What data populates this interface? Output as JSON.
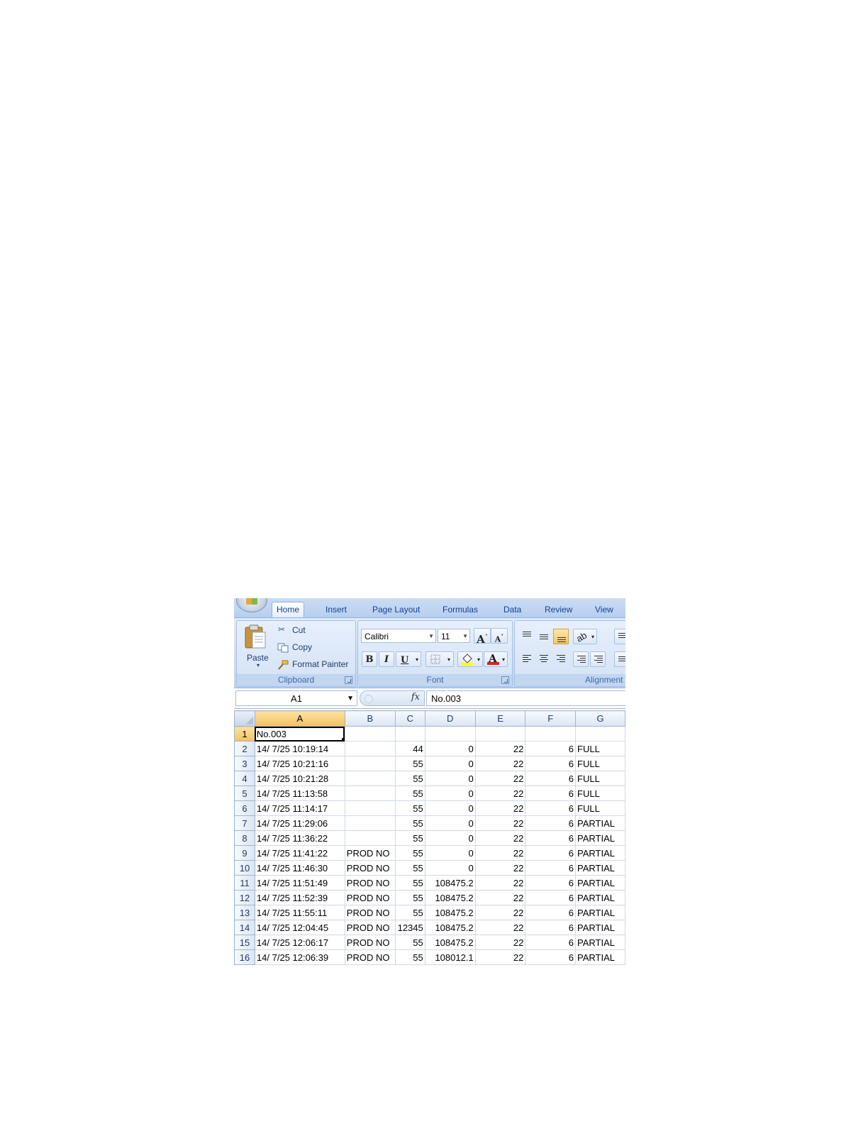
{
  "ribbon": {
    "tabs": [
      "Home",
      "Insert",
      "Page Layout",
      "Formulas",
      "Data",
      "Review",
      "View"
    ],
    "active_tab": "Home",
    "clipboard": {
      "paste_label": "Paste",
      "cut_label": "Cut",
      "copy_label": "Copy",
      "format_painter_label": "Format Painter",
      "group_label": "Clipboard"
    },
    "font": {
      "font_name": "Calibri",
      "font_size": "11",
      "group_label": "Font",
      "bold": "B",
      "italic": "I",
      "underline": "U",
      "grow": "A",
      "shrink": "A",
      "font_color_glyph": "A",
      "font_color": "#e02020",
      "fill_color": "#ffff00"
    },
    "alignment": {
      "group_label": "Alignment",
      "active_vertical": "bottom"
    }
  },
  "formula_bar": {
    "name_box": "A1",
    "fx": "fx",
    "formula": "No.003"
  },
  "sheet": {
    "columns": [
      "A",
      "B",
      "C",
      "D",
      "E",
      "F",
      "G"
    ],
    "selected_column": "A",
    "selected_row": "1",
    "rows": [
      {
        "n": "1",
        "a": "No.003",
        "b": "",
        "c": "",
        "d": "",
        "e": "",
        "f": "",
        "g": ""
      },
      {
        "n": "2",
        "a": "14/ 7/25 10:19:14",
        "b": "",
        "c": "44",
        "d": "0",
        "e": "22",
        "f": "6",
        "g": "FULL"
      },
      {
        "n": "3",
        "a": "14/ 7/25 10:21:16",
        "b": "",
        "c": "55",
        "d": "0",
        "e": "22",
        "f": "6",
        "g": "FULL"
      },
      {
        "n": "4",
        "a": "14/ 7/25 10:21:28",
        "b": "",
        "c": "55",
        "d": "0",
        "e": "22",
        "f": "6",
        "g": "FULL"
      },
      {
        "n": "5",
        "a": "14/ 7/25 11:13:58",
        "b": "",
        "c": "55",
        "d": "0",
        "e": "22",
        "f": "6",
        "g": "FULL"
      },
      {
        "n": "6",
        "a": "14/ 7/25 11:14:17",
        "b": "",
        "c": "55",
        "d": "0",
        "e": "22",
        "f": "6",
        "g": "FULL"
      },
      {
        "n": "7",
        "a": "14/ 7/25 11:29:06",
        "b": "",
        "c": "55",
        "d": "0",
        "e": "22",
        "f": "6",
        "g": "PARTIAL"
      },
      {
        "n": "8",
        "a": "14/ 7/25 11:36:22",
        "b": "",
        "c": "55",
        "d": "0",
        "e": "22",
        "f": "6",
        "g": "PARTIAL"
      },
      {
        "n": "9",
        "a": "14/ 7/25 11:41:22",
        "b": "PROD NO",
        "c": "55",
        "d": "0",
        "e": "22",
        "f": "6",
        "g": "PARTIAL"
      },
      {
        "n": "10",
        "a": "14/ 7/25 11:46:30",
        "b": "PROD NO",
        "c": "55",
        "d": "0",
        "e": "22",
        "f": "6",
        "g": "PARTIAL"
      },
      {
        "n": "11",
        "a": "14/ 7/25 11:51:49",
        "b": "PROD NO",
        "c": "55",
        "d": "108475.2",
        "e": "22",
        "f": "6",
        "g": "PARTIAL"
      },
      {
        "n": "12",
        "a": "14/ 7/25 11:52:39",
        "b": "PROD NO",
        "c": "55",
        "d": "108475.2",
        "e": "22",
        "f": "6",
        "g": "PARTIAL"
      },
      {
        "n": "13",
        "a": "14/ 7/25 11:55:11",
        "b": "PROD NO",
        "c": "55",
        "d": "108475.2",
        "e": "22",
        "f": "6",
        "g": "PARTIAL"
      },
      {
        "n": "14",
        "a": "14/ 7/25 12:04:45",
        "b": "PROD NO",
        "c": "12345",
        "d": "108475.2",
        "e": "22",
        "f": "6",
        "g": "PARTIAL"
      },
      {
        "n": "15",
        "a": "14/ 7/25 12:06:17",
        "b": "PROD NO",
        "c": "55",
        "d": "108475.2",
        "e": "22",
        "f": "6",
        "g": "PARTIAL"
      },
      {
        "n": "16",
        "a": "14/ 7/25 12:06:39",
        "b": "PROD NO",
        "c": "55",
        "d": "108012.1",
        "e": "22",
        "f": "6",
        "g": "PARTIAL"
      }
    ]
  }
}
